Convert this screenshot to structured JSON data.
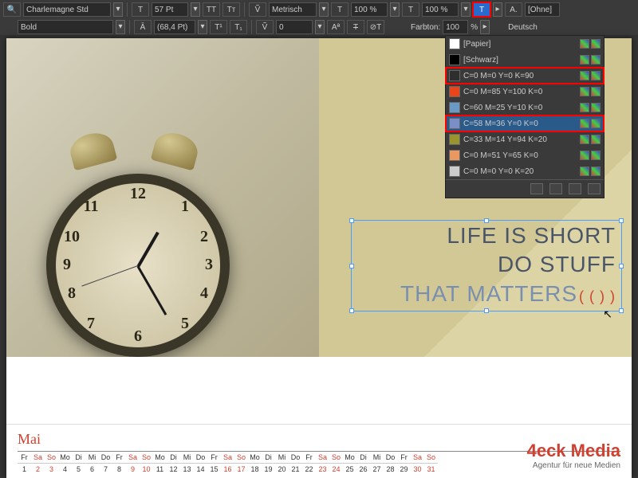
{
  "toolbar": {
    "font_family": "Charlemagne Std",
    "font_style": "Bold",
    "font_size": "57 Pt",
    "leading": "(68,4 Pt)",
    "kerning_mode": "Metrisch",
    "kerning": "0",
    "hscale": "100 %",
    "vscale": "100 %",
    "tint_label": "Farbton:",
    "tint": "100",
    "tint_unit": "%",
    "lang": "Deutsch",
    "no_style": "[Ohne]"
  },
  "swatches": [
    {
      "name": "[Papier]",
      "color": "#ffffff",
      "sel": false,
      "hi": false
    },
    {
      "name": "[Schwarz]",
      "color": "#000000",
      "sel": false,
      "hi": false
    },
    {
      "name": "C=0 M=0 Y=0 K=90",
      "color": "#2e2e2e",
      "sel": false,
      "hi": true
    },
    {
      "name": "C=0 M=85 Y=100 K=0",
      "color": "#e8451a",
      "sel": false,
      "hi": false
    },
    {
      "name": "C=60 M=25 Y=10 K=0",
      "color": "#6a9ac4",
      "sel": false,
      "hi": false
    },
    {
      "name": "C=58 M=36 Y=0 K=0",
      "color": "#7a8fc8",
      "sel": true,
      "hi": true
    },
    {
      "name": "C=33 M=14 Y=94 K=20",
      "color": "#9a9430",
      "sel": false,
      "hi": false
    },
    {
      "name": "C=0 M=51 Y=65 K=0",
      "color": "#e89860",
      "sel": false,
      "hi": false
    },
    {
      "name": "C=0 M=0 Y=0 K=20",
      "color": "#cccccc",
      "sel": false,
      "hi": false
    }
  ],
  "quote": {
    "line1": "LIFE IS SHORT",
    "line2": "DO STUFF",
    "line3": "THAT MATTERS",
    "overset": "( ( ) )"
  },
  "calendar": {
    "month": "Mai",
    "day_abbr": [
      "Fr",
      "Sa",
      "So",
      "Mo",
      "Di",
      "Mi",
      "Do",
      "Fr",
      "Sa",
      "So",
      "Mo",
      "Di",
      "Mi",
      "Do",
      "Fr",
      "Sa",
      "So",
      "Mo",
      "Di",
      "Mi",
      "Do",
      "Fr",
      "Sa",
      "So",
      "Mo",
      "Di",
      "Mi",
      "Do",
      "Fr",
      "Sa",
      "So"
    ],
    "day_num": [
      "1",
      "2",
      "3",
      "4",
      "5",
      "6",
      "7",
      "8",
      "9",
      "10",
      "11",
      "12",
      "13",
      "14",
      "15",
      "16",
      "17",
      "18",
      "19",
      "20",
      "21",
      "22",
      "23",
      "24",
      "25",
      "26",
      "27",
      "28",
      "29",
      "30",
      "31"
    ],
    "weekend_idx": [
      1,
      2,
      8,
      9,
      15,
      16,
      22,
      23,
      29,
      30
    ]
  },
  "brand": {
    "name": "4eck Media",
    "tag": "Agentur für neue Medien"
  }
}
